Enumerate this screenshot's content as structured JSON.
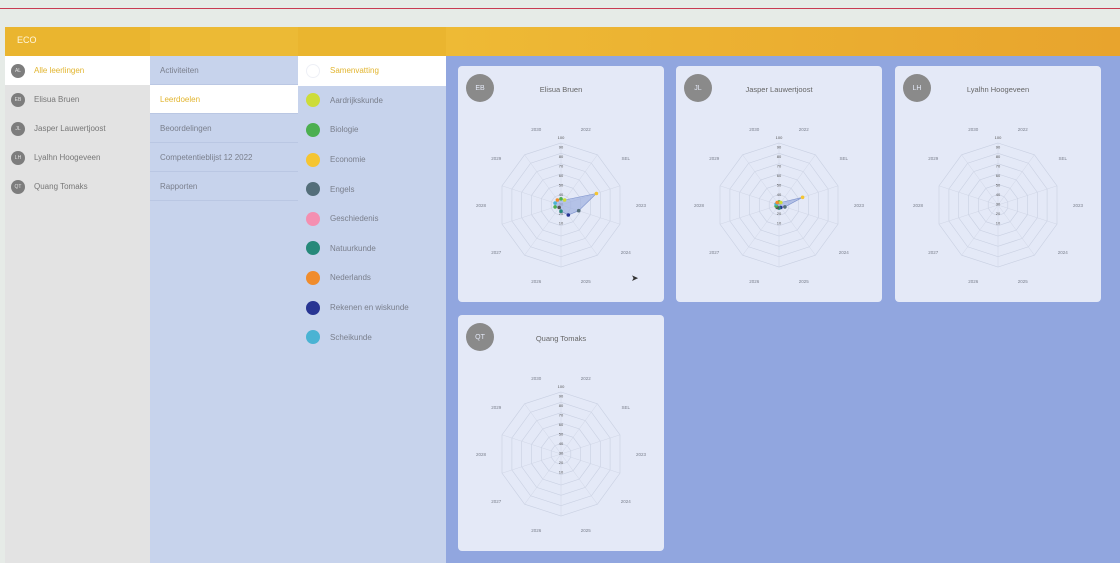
{
  "app": {
    "title": "ECO"
  },
  "students": [
    {
      "initials": "AL",
      "name": "Alle leerlingen",
      "active": true
    },
    {
      "initials": "EB",
      "name": "Elisua Bruen",
      "active": false
    },
    {
      "initials": "JL",
      "name": "Jasper Lauwertjoost",
      "active": false
    },
    {
      "initials": "LH",
      "name": "Lyalhn Hoogeveen",
      "active": false
    },
    {
      "initials": "QT",
      "name": "Quang Tomaks",
      "active": false
    }
  ],
  "menu": [
    {
      "label": "Activiteiten",
      "active": false
    },
    {
      "label": "Leerdoelen",
      "active": true
    },
    {
      "label": "Beoordelingen",
      "active": false
    },
    {
      "label": "Competentieblijst 12 2022",
      "active": false
    },
    {
      "label": "Rapporten",
      "active": false
    }
  ],
  "subjects": [
    {
      "label": "Samenvatting",
      "color": "#ffffff",
      "active": true
    },
    {
      "label": "Aardrijkskunde",
      "color": "#cddc39",
      "active": false
    },
    {
      "label": "Biologie",
      "color": "#4caf50",
      "active": false
    },
    {
      "label": "Economie",
      "color": "#f5c531",
      "active": false
    },
    {
      "label": "Engels",
      "color": "#546e7a",
      "active": false
    },
    {
      "label": "Geschiedenis",
      "color": "#f48fb1",
      "active": false
    },
    {
      "label": "Natuurkunde",
      "color": "#26897a",
      "active": false
    },
    {
      "label": "Nederlands",
      "color": "#f08c2c",
      "active": false
    },
    {
      "label": "Rekenen en wiskunde",
      "color": "#283593",
      "active": false
    },
    {
      "label": "Scheikunde",
      "color": "#4ab3d3",
      "active": false
    }
  ],
  "cards": [
    {
      "initials": "EB",
      "name": "Elisua Bruen"
    },
    {
      "initials": "JL",
      "name": "Jasper Lauwertjoost"
    },
    {
      "initials": "LH",
      "name": "Lyalhn Hoogeveen"
    },
    {
      "initials": "QT",
      "name": "Quang Tomaks"
    }
  ],
  "radar_axis_labels": [
    "2022",
    "SEL",
    "2023",
    "2024",
    "2025",
    "2026",
    "2027",
    "2028",
    "2029",
    "2030"
  ],
  "radar_scale_labels": [
    "100",
    "90",
    "80",
    "70",
    "60",
    "50",
    "40",
    "30",
    "20",
    "10"
  ],
  "chart_data": [
    {
      "type": "radar",
      "title": "Elisua Bruen",
      "axes": [
        "2022",
        "SEL",
        "2023",
        "2024",
        "2025",
        "2026",
        "2027",
        "2028",
        "2029",
        "2030"
      ],
      "series": [
        {
          "values": [
            10,
            10,
            60,
            30,
            20,
            10,
            5,
            10,
            10,
            10
          ],
          "color": "#4caf50"
        }
      ]
    },
    {
      "type": "radar",
      "title": "Jasper Lauwertjoost",
      "axes": [
        "2022",
        "SEL",
        "2023",
        "2024",
        "2025",
        "2026",
        "2027",
        "2028",
        "2029",
        "2030"
      ],
      "series": [
        {
          "values": [
            5,
            5,
            40,
            10,
            5,
            5,
            5,
            5,
            5,
            5
          ],
          "color": "#f5c531"
        }
      ]
    },
    {
      "type": "radar",
      "title": "Lyalhn Hoogeveen",
      "axes": [
        "2022",
        "SEL",
        "2023",
        "2024",
        "2025",
        "2026",
        "2027",
        "2028",
        "2029",
        "2030"
      ],
      "series": []
    },
    {
      "type": "radar",
      "title": "Quang Tomaks",
      "axes": [
        "2022",
        "SEL",
        "2023",
        "2024",
        "2025",
        "2026",
        "2027",
        "2028",
        "2029",
        "2030"
      ],
      "series": []
    }
  ]
}
